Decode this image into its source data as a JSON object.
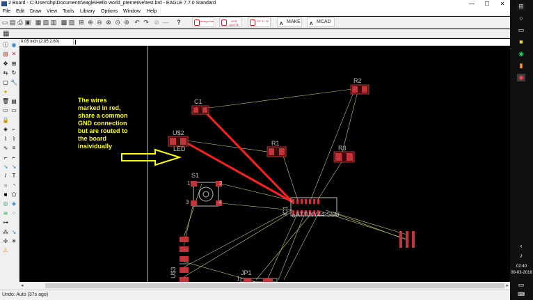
{
  "window": {
    "title": "2 Board - C:\\Users\\hp\\Documents\\eagle\\Hello world_premetive\\test.brd - EAGLE 7.7.0 Standard",
    "minimize": "—",
    "maximize": "☐",
    "close": "✕"
  },
  "menu": {
    "items": [
      "File",
      "Edit",
      "Draw",
      "View",
      "Tools",
      "Library",
      "Options",
      "Window",
      "Help"
    ]
  },
  "toolbar": {
    "buttons": [
      "open-icon",
      "save-icon",
      "print-icon",
      "cam-icon",
      "script-icon",
      "run-icon",
      "zoom-fit-icon",
      "zoom-in-icon",
      "zoom-out-icon",
      "zoom-redraw-icon",
      "zoom-area-icon",
      "undo-icon",
      "redo-icon",
      "stop-icon",
      "go-icon",
      "help-icon"
    ],
    "pill_labels": [
      "design link",
      "PCB QUOTE",
      "EF 11 20",
      "MAKE",
      "MCAD"
    ]
  },
  "coord": {
    "readout": "0.05 inch (2.05 2.60)"
  },
  "annotation": {
    "text": "The wires\nmarked in red,\nshare a common\nGND connection\nbut are routed to\nthe board\ninsividually",
    "color": "#ffff00"
  },
  "board": {
    "labels": [
      "C1",
      "R2",
      "U$2",
      "LED",
      "R1",
      "R3",
      "S1",
      "1",
      "2",
      "3",
      "4",
      "IC1",
      "ATTINY44-SSU",
      "U$3",
      "JP1",
      "1"
    ]
  },
  "colors": {
    "highlight_wire": "#ff2020",
    "airwire": "#c8c870",
    "pad": "#c0353a",
    "canvas": "#000000"
  },
  "status": {
    "text": "Undo: Auto (37s ago)"
  },
  "taskbar": {
    "time": "02:40",
    "date": "09-03-2018"
  }
}
